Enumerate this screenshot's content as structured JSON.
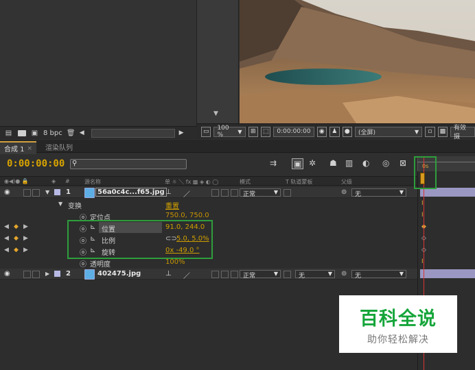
{
  "project": {
    "bpc": "8 bpc"
  },
  "viewer": {
    "zoom": "100 %",
    "timecode": "0:00:00:00",
    "resolution": "(全屏)",
    "active_camera": "有效摄"
  },
  "tabs": [
    {
      "label": "合成 1",
      "close": "×"
    },
    {
      "label": "渲染队列"
    }
  ],
  "timeline": {
    "timecode": "0:00:00:00",
    "search_placeholder": "",
    "ruler_marker": "0s"
  },
  "columns": {
    "source_name": "源名称",
    "switches": "单 ☼ ＼ fx ▩ ◈ ◐ ◯",
    "mode": "模式",
    "trkmat": "T  轨道蒙板",
    "parent": "父级"
  },
  "layers": [
    {
      "num": "1",
      "name": "56a0c4c...f65.jpg",
      "mode": "正常",
      "parent": "无"
    },
    {
      "num": "2",
      "name": "402475.jpg",
      "mode": "正常",
      "trkmat": "无",
      "parent": "无"
    }
  ],
  "transform": {
    "label": "变换",
    "reset": "重置",
    "anchor": {
      "label": "定位点",
      "value": "750.0, 750.0"
    },
    "position": {
      "label": "位置",
      "value": "91.0, 244.0"
    },
    "scale": {
      "label": "比例",
      "value": "5.0, 5.0%"
    },
    "rotation": {
      "label": "旋转",
      "value": "0x -49.0 °"
    },
    "opacity": {
      "label": "透明度",
      "value": "100%"
    }
  },
  "watermark": {
    "title": "百科全说",
    "subtitle": "助你轻松解决"
  },
  "colors": {
    "accent": "#d0a000",
    "highlight_box": "#2e9e3c",
    "layer_label": "#b7b9e4",
    "watermark_green": "#15a53a"
  }
}
